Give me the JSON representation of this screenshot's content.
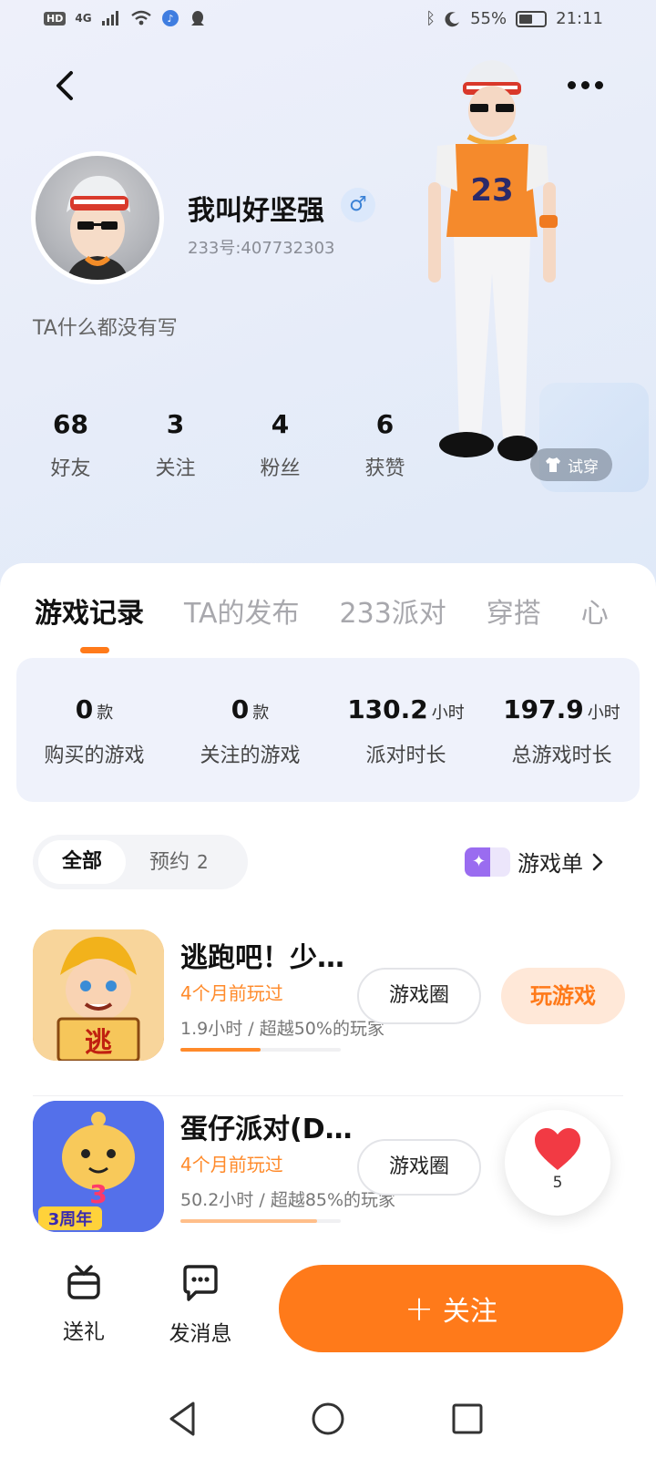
{
  "status_bar": {
    "hd": "HD",
    "network": "4G",
    "battery_percent": "55%",
    "battery_level": 0.55,
    "time": "21:11"
  },
  "header": {
    "back_icon": "chevron-left-icon",
    "more_icon": "more-horizontal-icon"
  },
  "profile": {
    "name": "我叫好坚强",
    "gender_symbol": "♂",
    "uid": "233号:407732303",
    "bio": "TA什么都没有写",
    "try_on_label": "试穿",
    "stats": [
      {
        "value": "68",
        "label": "好友"
      },
      {
        "value": "3",
        "label": "关注"
      },
      {
        "value": "4",
        "label": "粉丝"
      },
      {
        "value": "6",
        "label": "获赞"
      }
    ]
  },
  "tabs": [
    {
      "label": "游戏记录",
      "active": true
    },
    {
      "label": "TA的发布",
      "active": false
    },
    {
      "label": "233派对",
      "active": false
    },
    {
      "label": "穿搭",
      "active": false
    },
    {
      "label": "心",
      "active": false
    }
  ],
  "summary": [
    {
      "value": "0",
      "unit": "款",
      "label": "购买的游戏"
    },
    {
      "value": "0",
      "unit": "款",
      "label": "关注的游戏"
    },
    {
      "value": "130.2",
      "unit": "小时",
      "label": "派对时长"
    },
    {
      "value": "197.9",
      "unit": "小时",
      "label": "总游戏时长"
    }
  ],
  "filter": {
    "all_label": "全部",
    "reserve_label": "预约",
    "reserve_count": "2"
  },
  "game_list_link": {
    "label": "游戏单",
    "icon": "sparkle-icon",
    "accent": "#9a6cf0"
  },
  "games": [
    {
      "title": "逃跑吧！少…",
      "played": "4个月前玩过",
      "hours": "1.9小时",
      "sep": "/",
      "beat": "超越50%的玩家",
      "progress": 0.5,
      "circle_label": "游戏圈",
      "play_label": "玩游戏",
      "icon_char": "逃"
    },
    {
      "title": "蛋仔派对(D…",
      "played": "4个月前玩过",
      "hours": "50.2小时",
      "sep": "/",
      "beat": "超越85%的玩家",
      "progress": 0.85,
      "circle_label": "游戏圈",
      "icon_char": "3",
      "badge": "3周年"
    }
  ],
  "like": {
    "count": "5"
  },
  "bottom": {
    "gift_label": "送礼",
    "message_label": "发消息",
    "follow_label": "关注",
    "follow_plus": "+"
  },
  "colors": {
    "accent": "#ff7a1a",
    "played_text": "#ff8a2a",
    "summary_bg": "#eff2fb"
  }
}
